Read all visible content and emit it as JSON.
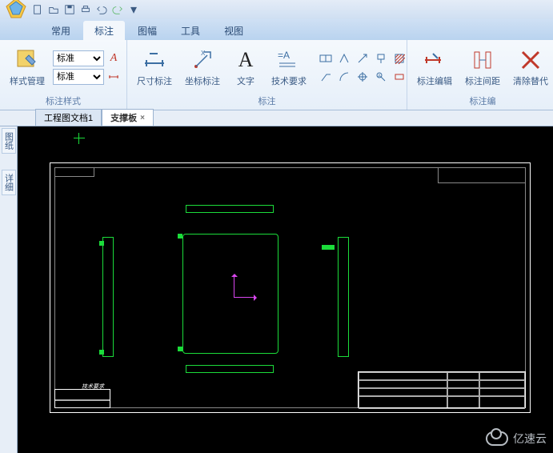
{
  "qat": {
    "icons": [
      "new",
      "open",
      "save",
      "print",
      "undo",
      "redo",
      "dropdown"
    ]
  },
  "tabs": {
    "items": [
      "常用",
      "标注",
      "图幅",
      "工具",
      "视图"
    ],
    "active": 1
  },
  "ribbon": {
    "group1": {
      "label": "标注样式",
      "style_mgr": "样式管理",
      "combo1": "标准",
      "combo2": "标准"
    },
    "group2": {
      "label": "标注",
      "dim": "尺寸标注",
      "coord": "坐标标注",
      "text": "文字",
      "tech": "技术要求"
    },
    "group3": {
      "label": "标注编",
      "edit": "标注编辑",
      "spacing": "标注间距",
      "clear": "清除替代"
    }
  },
  "doctabs": {
    "items": [
      "工程图文档1",
      "支撑板"
    ],
    "active": 1
  },
  "sidebar": {
    "items": [
      "图纸",
      "详细"
    ]
  },
  "cad": {
    "note": "技术要求"
  },
  "watermark": "亿速云"
}
